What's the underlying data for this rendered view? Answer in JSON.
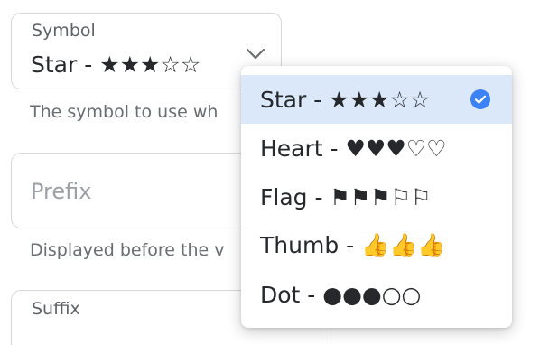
{
  "symbol_field": {
    "label": "Symbol",
    "value": "Star - ★★★☆☆",
    "helper": "The symbol to use wh",
    "chevron_icon": "chevron-down-icon"
  },
  "prefix_field": {
    "placeholder": "Prefix",
    "helper": "Displayed before the v"
  },
  "suffix_field": {
    "label": "Suffix"
  },
  "dropdown": {
    "options": [
      {
        "label": "Star - ★★★☆☆",
        "selected": true
      },
      {
        "label": "Heart - ♥♥♥♡♡",
        "selected": false
      },
      {
        "label": "Flag - ⚑⚑⚑⚐⚐",
        "selected": false
      },
      {
        "label": "Thumb - 👍👍👍",
        "selected": false
      },
      {
        "label": "Dot - ●●●○○",
        "selected": false
      }
    ],
    "check_icon": "check-circle-icon"
  },
  "colors": {
    "selected_background": "#dbe8fa",
    "accent": "#3b82f6",
    "border": "#d5d7da"
  }
}
